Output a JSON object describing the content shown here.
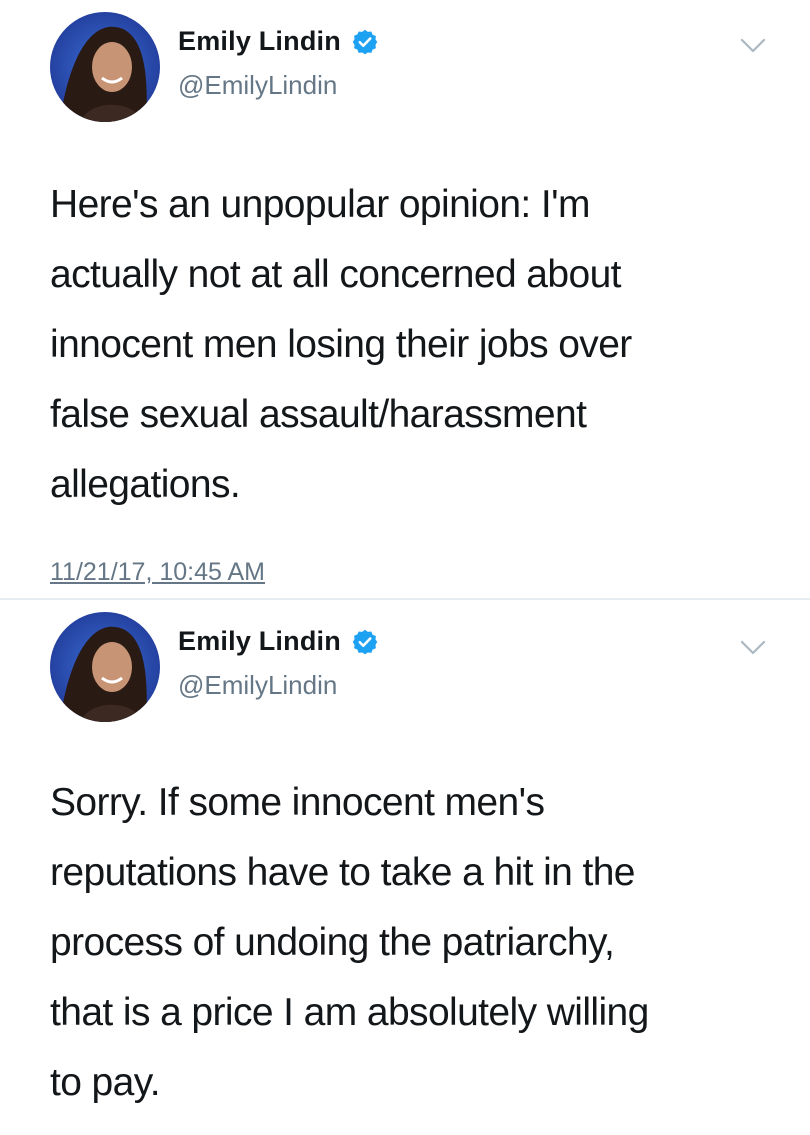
{
  "tweets": [
    {
      "author": {
        "name": "Emily Lindin",
        "handle": "@EmilyLindin",
        "verified_icon": "verified-badge-icon",
        "badge_color": "#1da1f2"
      },
      "text": "Here's an unpopular opinion: I'm\nactually not at all concerned about\ninnocent men losing their jobs over\nfalse sexual assault/harassment\nallegations.",
      "timestamp": "11/21/17, 10:45 AM"
    },
    {
      "author": {
        "name": "Emily Lindin",
        "handle": "@EmilyLindin",
        "verified_icon": "verified-badge-icon",
        "badge_color": "#1da1f2"
      },
      "text": "Sorry. If some innocent men's\nreputations have to take a hit in the\nprocess of undoing the patriarchy,\nthat is a price I am absolutely willing\nto pay."
    }
  ]
}
